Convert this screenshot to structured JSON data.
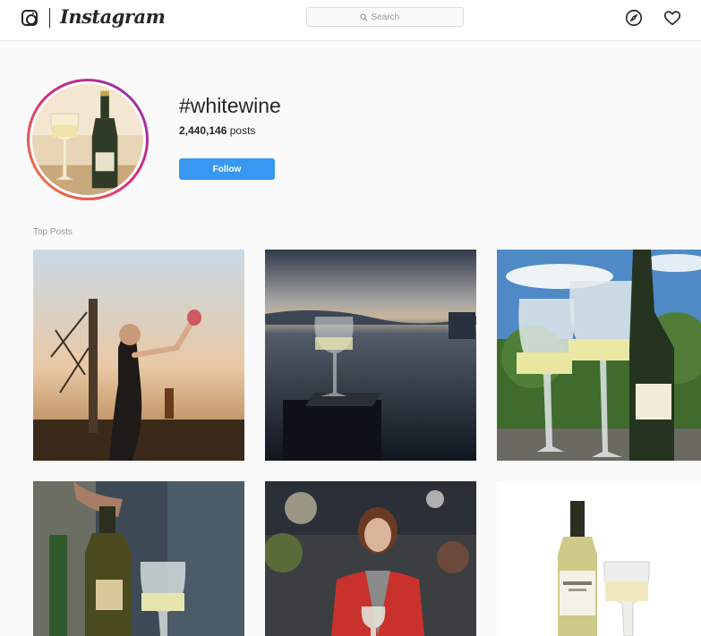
{
  "header": {
    "logo_icon": "instagram-camera-icon",
    "wordmark": "Instagram",
    "search_placeholder": "Search",
    "nav_icons": [
      "compass-icon",
      "heart-icon"
    ]
  },
  "hashtag": {
    "title": "#whitewine",
    "post_count": "2,440,146",
    "posts_suffix": " posts",
    "follow_label": "Follow"
  },
  "section": {
    "top_posts_label": "Top Posts"
  },
  "posts": [
    {
      "subject": "woman raising wine glass at sunset"
    },
    {
      "subject": "wine glass on pier at dusk over lake"
    },
    {
      "subject": "two white wine glasses and bottle outdoors"
    },
    {
      "subject": "hand holding wine bottle next to glass"
    },
    {
      "subject": "woman in red jacket at event"
    },
    {
      "subject": "white wine bottle and glass on white"
    }
  ],
  "colors": {
    "accent": "#3897f0",
    "ring_start": "#f58529",
    "ring_end": "#8134af",
    "text": "#262626",
    "muted": "#999999"
  }
}
